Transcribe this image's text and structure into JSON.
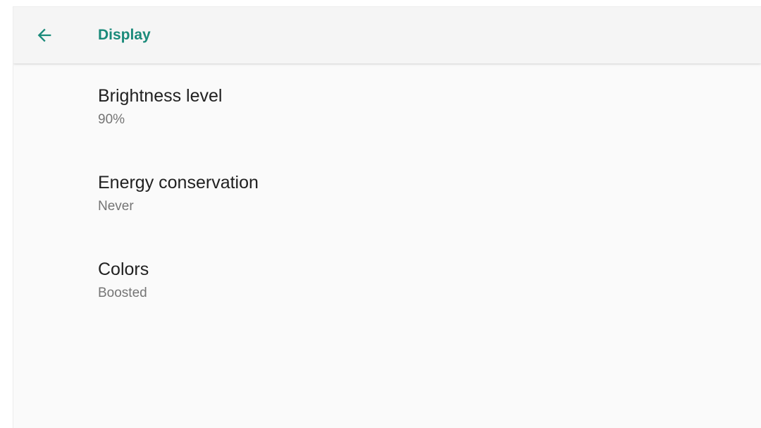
{
  "toolbar": {
    "title": "Display",
    "back_icon": "arrow-back-icon",
    "accent_color": "#1a8a7a"
  },
  "settings": [
    {
      "title": "Brightness level",
      "summary": "90%"
    },
    {
      "title": "Energy conservation",
      "summary": "Never"
    },
    {
      "title": "Colors",
      "summary": "Boosted"
    }
  ]
}
